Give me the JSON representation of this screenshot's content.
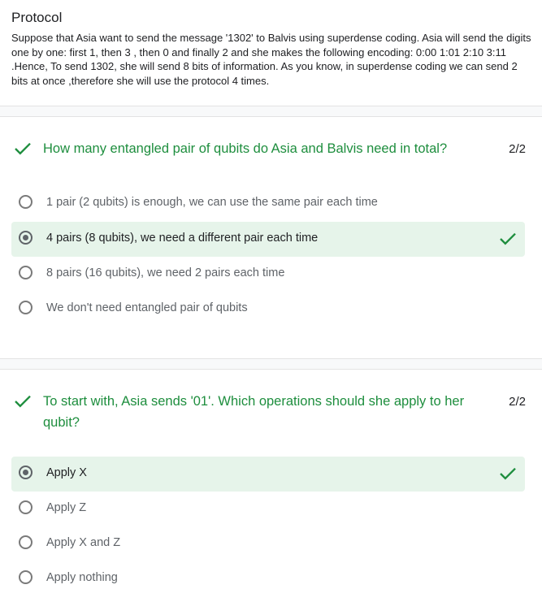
{
  "intro": {
    "title": "Protocol",
    "body": "Suppose that Asia want to send the message '1302' to Balvis using superdense coding. Asia will send the digits one by one: first 1, then 3 , then 0 and finally 2 and she makes the following encoding:  0:00 1:01 2:10 3:11 .Hence, To send 1302, she will send 8 bits of information. As you know, in superdense coding we can send 2 bits at once ,therefore she will use the protocol 4 times."
  },
  "questions": [
    {
      "text": "How many entangled pair of qubits do Asia and Balvis need in total?",
      "score": "2/2",
      "status_icon": "check-icon",
      "options": [
        {
          "label": "1 pair (2 qubits) is enough, we can use the same pair each time",
          "selected": false
        },
        {
          "label": "4 pairs (8 qubits), we need a different pair each time",
          "selected": true,
          "correct": true
        },
        {
          "label": "8 pairs (16 qubits), we need 2 pairs each time",
          "selected": false
        },
        {
          "label": "We don't need entangled pair of qubits",
          "selected": false
        }
      ]
    },
    {
      "text": "To start with, Asia sends '01'. Which operations should she apply to her qubit?",
      "score": "2/2",
      "status_icon": "check-icon",
      "options": [
        {
          "label": "Apply X",
          "selected": true,
          "correct": true
        },
        {
          "label": "Apply Z",
          "selected": false
        },
        {
          "label": "Apply X and Z",
          "selected": false
        },
        {
          "label": "Apply nothing",
          "selected": false
        }
      ]
    }
  ],
  "colors": {
    "correct_green": "#1e8e3e",
    "selected_bg": "#e6f4ea",
    "section_separator": "#f8f9fa"
  }
}
